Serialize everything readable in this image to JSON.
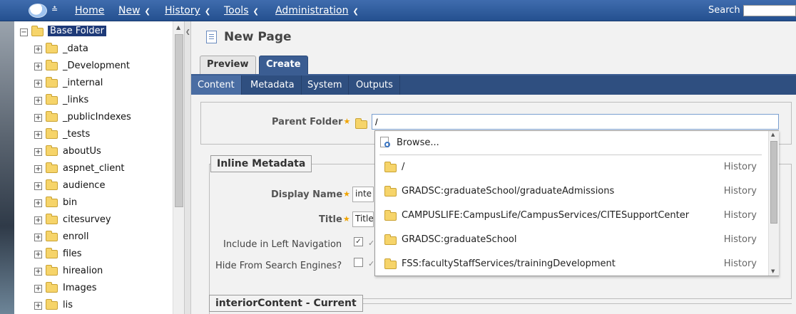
{
  "topbar": {
    "menu": [
      {
        "label": "Home",
        "chevron": false
      },
      {
        "label": "New",
        "chevron": true
      },
      {
        "label": "History",
        "chevron": true
      },
      {
        "label": "Tools",
        "chevron": true
      },
      {
        "label": "Administration",
        "chevron": true
      }
    ],
    "search_label": "Search",
    "search_value": ""
  },
  "tree": {
    "root": "Base Folder",
    "items": [
      "_data",
      "_Development",
      "_internal",
      "_links",
      "_publicIndexes",
      "_tests",
      "aboutUs",
      "aspnet_client",
      "audience",
      "bin",
      "citesurvey",
      "enroll",
      "files",
      "hirealion",
      "Images",
      "lis"
    ]
  },
  "main": {
    "title": "New Page",
    "buttons": {
      "preview": "Preview",
      "create": "Create"
    },
    "tabs": [
      "Content",
      "Metadata",
      "System",
      "Outputs"
    ],
    "active_tab": "Content",
    "parent_folder": {
      "label": "Parent Folder",
      "value": "/"
    },
    "inline_metadata": {
      "legend": "Inline Metadata",
      "display_name": {
        "label": "Display Name",
        "value": "inte"
      },
      "title": {
        "label": "Title",
        "value": "Title"
      },
      "include_left_nav": {
        "label": "Include in Left Navigation",
        "checked": true
      },
      "hide_search": {
        "label": "Hide From Search Engines?",
        "checked": false
      },
      "cb_suffix": "✓"
    },
    "interior_legend": "interiorContent - Current"
  },
  "dropdown": {
    "browse_label": "Browse...",
    "items": [
      {
        "path": "/",
        "tag": "History"
      },
      {
        "path": "GRADSC:graduateSchool/graduateAdmissions",
        "tag": "History"
      },
      {
        "path": "CAMPUSLIFE:CampusLife/CampusServices/CITESupportCenter",
        "tag": "History"
      },
      {
        "path": "GRADSC:graduateSchool",
        "tag": "History"
      },
      {
        "path": "FSS:facultyStaffServices/trainingDevelopment",
        "tag": "History"
      }
    ]
  },
  "colors": {
    "accent": "#2f4f80",
    "selected": "#1e3a78",
    "folder": "#f6d46a",
    "required_star": "#f0a400"
  }
}
